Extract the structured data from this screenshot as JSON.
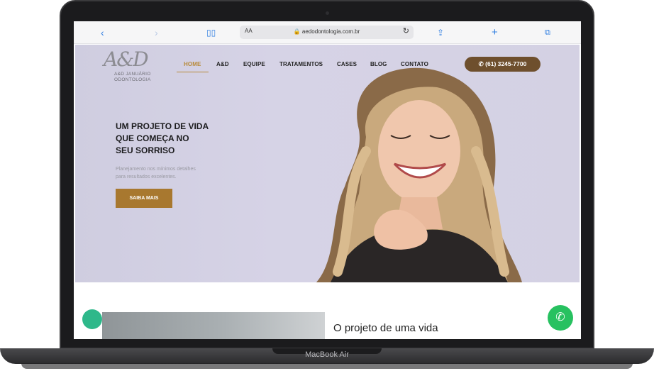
{
  "device": {
    "model_label": "MacBook Air"
  },
  "browser": {
    "text_size_label": "AA",
    "url": "aedodontologia.com.br",
    "icons": [
      "back-icon",
      "forward-icon",
      "bookmarks-icon",
      "reload-icon",
      "share-icon",
      "new-tab-icon",
      "tabs-icon"
    ]
  },
  "site": {
    "logo": {
      "mark": "A&D",
      "name_line1": "A&D JANUÁRIO",
      "name_line2": "ODONTOLOGIA"
    },
    "nav": [
      "HOME",
      "A&D",
      "EQUIPE",
      "TRATAMENTOS",
      "CASES",
      "BLOG",
      "CONTATO"
    ],
    "active_nav": "HOME",
    "phone": "(61) 3245-7700",
    "hero": {
      "headline_line1": "UM PROJETO DE VIDA",
      "headline_line2": "QUE COMEÇA NO",
      "headline_line3": "SEU SORRISO",
      "sub_line1": "Planejamento nos mínimos detalhes",
      "sub_line2": "para resultados excelentes.",
      "cta": "SAIBA MAIS"
    },
    "section2_title": "O projeto de uma vida"
  },
  "colors": {
    "accent_gold": "#b88a3a",
    "phone_button": "#6e4f2d",
    "whatsapp": "#27c160",
    "hero_bg": "#d4d1e3"
  }
}
